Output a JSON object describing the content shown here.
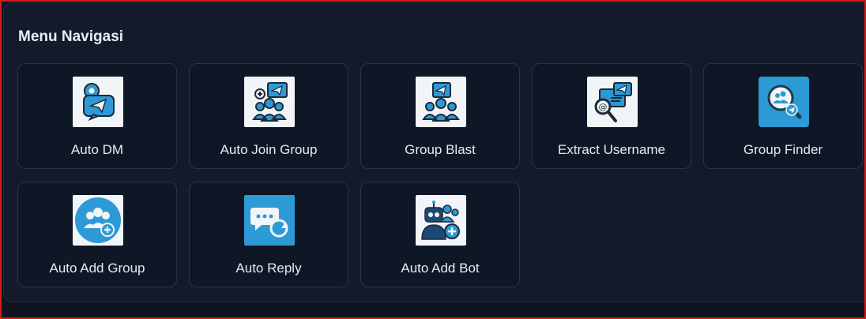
{
  "menu": {
    "title": "Menu Navigasi",
    "items": [
      {
        "label": "Auto DM",
        "icon": "auto-dm-icon"
      },
      {
        "label": "Auto Join Group",
        "icon": "auto-join-group-icon"
      },
      {
        "label": "Group Blast",
        "icon": "group-blast-icon"
      },
      {
        "label": "Extract Username",
        "icon": "extract-username-icon"
      },
      {
        "label": "Group Finder",
        "icon": "group-finder-icon"
      },
      {
        "label": "Auto Add Group",
        "icon": "auto-add-group-icon"
      },
      {
        "label": "Auto Reply",
        "icon": "auto-reply-icon"
      },
      {
        "label": "Auto Add Bot",
        "icon": "auto-add-bot-icon"
      }
    ]
  },
  "colors": {
    "background": "#0f1420",
    "panel": "#131b2b",
    "card": "#0f1626",
    "card_border": "#2a3346",
    "icon_blue": "#2d9ad6",
    "frame": "#d61b1b"
  }
}
